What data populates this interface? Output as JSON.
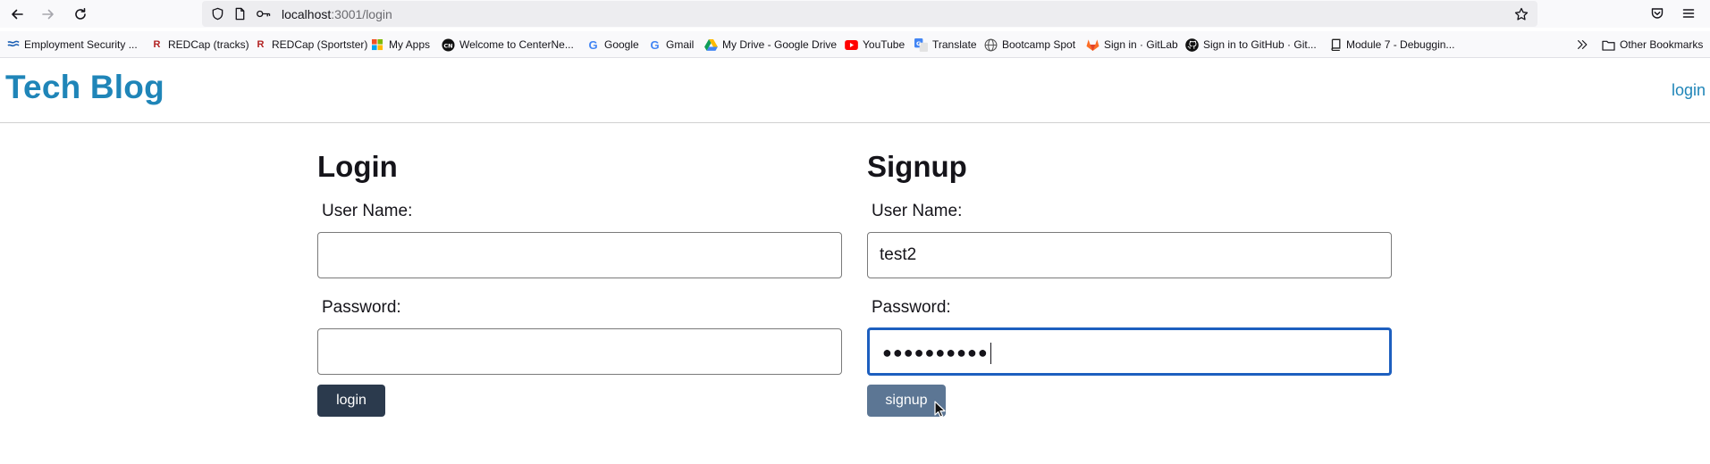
{
  "browser": {
    "url_host": "localhost",
    "url_path": ":3001/login",
    "bookmarks": [
      {
        "label": "Employment Security ...",
        "icon": "employment-icon",
        "color": "#1a5fb4"
      },
      {
        "label": "REDCap (tracks)",
        "icon": "redcap-icon",
        "color": "#b22222"
      },
      {
        "label": "REDCap (Sportster)",
        "icon": "redcap-icon",
        "color": "#b22222"
      },
      {
        "label": "My Apps",
        "icon": "microsoft-icon",
        "color": "#f25022"
      },
      {
        "label": "Welcome to CenterNe...",
        "icon": "centernet-icon",
        "color": "#000000"
      },
      {
        "label": "Google",
        "icon": "google-icon",
        "color": "#4285f4"
      },
      {
        "label": "Gmail",
        "icon": "google-icon",
        "color": "#4285f4"
      },
      {
        "label": "My Drive - Google Drive",
        "icon": "drive-icon",
        "color": "#0f9d58"
      },
      {
        "label": "YouTube",
        "icon": "youtube-icon",
        "color": "#ff0000"
      },
      {
        "label": "Translate",
        "icon": "translate-icon",
        "color": "#4285f4"
      },
      {
        "label": "Bootcamp Spot",
        "icon": "globe-icon",
        "color": "#555555"
      },
      {
        "label": "Sign in · GitLab",
        "icon": "gitlab-icon",
        "color": "#fc6d26"
      },
      {
        "label": "Sign in to GitHub · Git...",
        "icon": "github-icon",
        "color": "#000000"
      },
      {
        "label": "Module 7 - Debuggin...",
        "icon": "book-icon",
        "color": "#333333"
      }
    ],
    "other_bookmarks": "Other Bookmarks"
  },
  "header": {
    "brand": "Tech Blog",
    "nav_login": "login"
  },
  "login_form": {
    "title": "Login",
    "username_label": "User Name:",
    "username_value": "",
    "password_label": "Password:",
    "password_value": "",
    "submit_label": "login"
  },
  "signup_form": {
    "title": "Signup",
    "username_label": "User Name:",
    "username_value": "test2",
    "password_label": "Password:",
    "password_masked": "●●●●●●●●●●",
    "submit_label": "signup"
  },
  "colors": {
    "brand": "#1f85b8",
    "login_button": "#2b3a4d",
    "signup_button": "#5c7694",
    "focus_ring": "#1d5fbf"
  }
}
